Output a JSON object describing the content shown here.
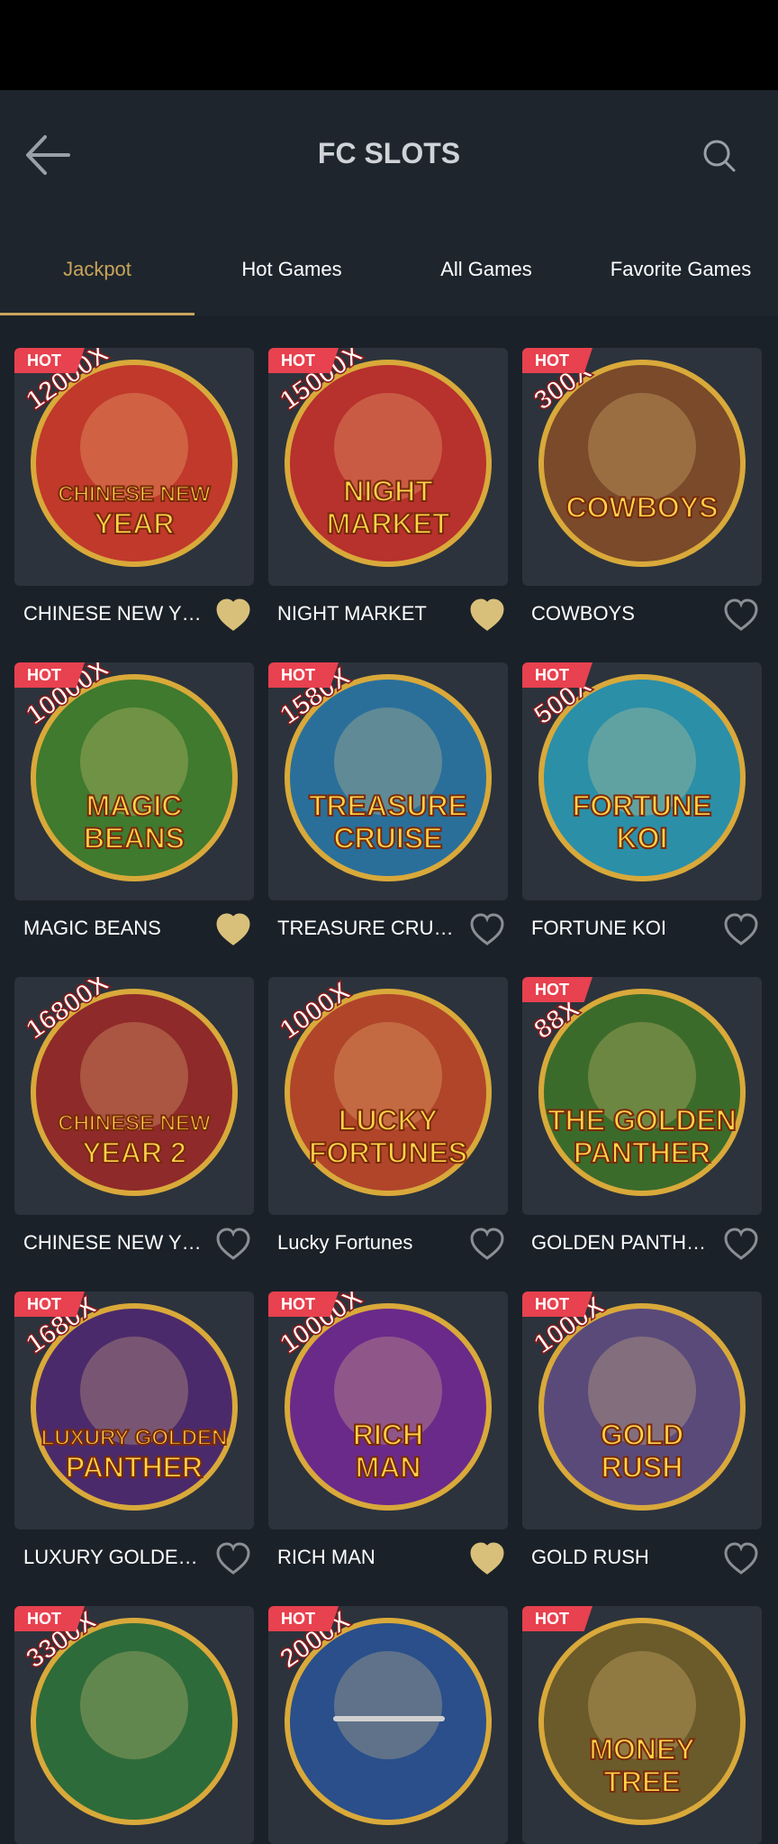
{
  "header": {
    "title": "FC SLOTS"
  },
  "tabs": [
    {
      "label": "Jackpot",
      "active": true
    },
    {
      "label": "Hot Games",
      "active": false
    },
    {
      "label": "All Games",
      "active": false
    },
    {
      "label": "Favorite Games",
      "active": false
    }
  ],
  "colors": {
    "accent": "#c9a45a",
    "hot_badge": "#e8414f",
    "background": "#1b2128",
    "header": "#1e252d"
  },
  "hot_label": "HOT",
  "games": [
    {
      "name": "CHINESE NEW YE...",
      "hot": true,
      "favorite": true,
      "art": "CHINESE NEW YEAR",
      "multiplier": "12000X",
      "color": "#c0392b"
    },
    {
      "name": "NIGHT MARKET",
      "hot": true,
      "favorite": true,
      "art": "NIGHT MARKET",
      "multiplier": "15000X",
      "color": "#b7312d"
    },
    {
      "name": "COWBOYS",
      "hot": true,
      "favorite": false,
      "art": "COWBOYS",
      "multiplier": "300X",
      "color": "#7a4a2a"
    },
    {
      "name": "MAGIC BEANS",
      "hot": true,
      "favorite": true,
      "art": "MAGIC BEANS",
      "multiplier": "10000X",
      "color": "#3f7a2e"
    },
    {
      "name": "TREASURE CRUISE",
      "hot": true,
      "favorite": false,
      "art": "TREASURE CRUISE",
      "multiplier": "1580X",
      "color": "#2a6f9a"
    },
    {
      "name": "FORTUNE KOI",
      "hot": true,
      "favorite": false,
      "art": "FORTUNE KOI",
      "multiplier": "500X",
      "color": "#2b8fa8"
    },
    {
      "name": "CHINESE NEW YE...",
      "hot": false,
      "favorite": false,
      "art": "CHINESE NEW YEAR 2",
      "multiplier": "16800X",
      "color": "#8e2a2a"
    },
    {
      "name": "Lucky Fortunes",
      "hot": false,
      "favorite": false,
      "art": "LUCKY FORTUNES",
      "multiplier": "1000X",
      "color": "#b0452a"
    },
    {
      "name": "GOLDEN PANTHER",
      "hot": true,
      "favorite": false,
      "art": "THE GOLDEN PANTHER",
      "multiplier": "88X",
      "color": "#3b6b2a"
    },
    {
      "name": "LUXURY GOLDEN ...",
      "hot": true,
      "favorite": false,
      "art": "LUXURY GOLDEN PANTHER",
      "multiplier": "1680X",
      "color": "#4b2a6b"
    },
    {
      "name": "RICH MAN",
      "hot": true,
      "favorite": true,
      "art": "RICH MAN",
      "multiplier": "10000X",
      "color": "#6a2a8a"
    },
    {
      "name": "GOLD RUSH",
      "hot": true,
      "favorite": false,
      "art": "GOLD RUSH",
      "multiplier": "1000X",
      "color": "#5a4a7a"
    },
    {
      "name": "",
      "hot": true,
      "favorite": false,
      "art": "",
      "multiplier": "3300X",
      "color": "#2e6b3a"
    },
    {
      "name": "",
      "hot": true,
      "favorite": false,
      "art": "",
      "multiplier": "2000X",
      "color": "#2a4f8a"
    },
    {
      "name": "",
      "hot": true,
      "favorite": false,
      "art": "MONEY TREE",
      "multiplier": "",
      "color": "#6b5a2a"
    }
  ]
}
